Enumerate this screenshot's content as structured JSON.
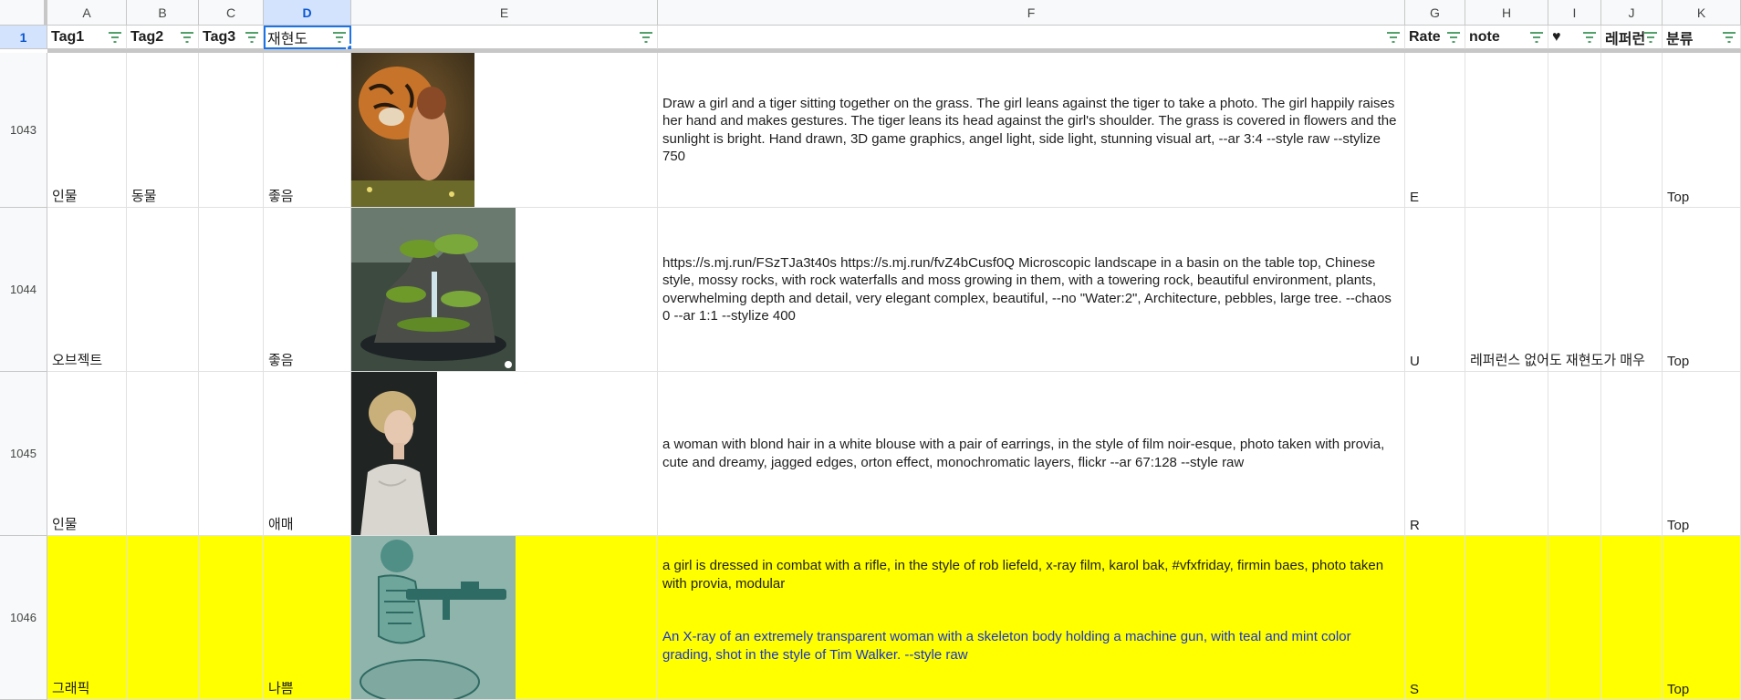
{
  "sheet": {
    "columns": [
      "A",
      "B",
      "C",
      "D",
      "E",
      "F",
      "G",
      "H",
      "I",
      "J",
      "K"
    ],
    "selected_column": "D",
    "header_row_number": "1",
    "headers": [
      "Tag1",
      "Tag2",
      "Tag3",
      "재현도",
      "",
      "",
      "Rate",
      "note",
      "♥",
      "레퍼런",
      "분류"
    ],
    "rows": [
      {
        "num": "1043",
        "tag1": "인물",
        "tag2": "동물",
        "tag3": "",
        "repro": "좋음",
        "prompt": "Draw a girl and a tiger sitting together on the grass. The girl leans against the tiger to take a photo. The girl happily raises her hand and makes gestures. The tiger leans its head against the girl's shoulder. The grass is covered in flowers and the sunlight is bright. Hand drawn, 3D game graphics, angel light, side light, stunning visual art, --ar 3:4 --style raw --stylize 750",
        "rate": "E",
        "note": "",
        "heart": "",
        "ref": "",
        "category": "Top"
      },
      {
        "num": "1044",
        "tag1": "오브젝트",
        "tag2": "",
        "tag3": "",
        "repro": "좋음",
        "prompt": "https://s.mj.run/FSzTJa3t40s https://s.mj.run/fvZ4bCusf0Q Microscopic landscape in a basin on the table top, Chinese style, mossy rocks, with rock waterfalls and moss growing in them, with a towering rock, beautiful environment, plants, overwhelming depth and detail, very elegant complex, beautiful, --no \"Water:2\", Architecture, pebbles, large tree. --chaos 0 --ar 1:1 --stylize 400",
        "rate": "U",
        "note": "레퍼런스 없어도 재현도가 매우",
        "heart": "",
        "ref": "",
        "category": "Top"
      },
      {
        "num": "1045",
        "tag1": "인물",
        "tag2": "",
        "tag3": "",
        "repro": "애매",
        "prompt": "a woman with blond hair in a white blouse with a pair of earrings, in the style of film noir-esque, photo taken with provia, cute and dreamy, jagged edges, orton effect, monochromatic layers, flickr --ar 67:128 --style raw",
        "rate": "R",
        "note": "",
        "heart": "",
        "ref": "",
        "category": "Top"
      },
      {
        "num": "1046",
        "tag1": "그래픽",
        "tag2": "",
        "tag3": "",
        "repro": "나쁨",
        "prompt": "a girl is dressed in combat with a rifle, in the style of rob liefeld, x-ray film, karol bak, #vfxfriday, firmin baes, photo taken with provia, modular",
        "prompt_extra": "An X-ray of an extremely transparent woman with a skeleton body holding a machine gun, with teal and mint color grading, shot in the style of Tim Walker. --style raw",
        "rate": "S",
        "note": "",
        "heart": "",
        "ref": "",
        "category": "Top"
      }
    ]
  },
  "colors": {
    "highlight_row": "#ffff00",
    "selection": "#1a73e8",
    "link_text": "#1a35c9"
  }
}
